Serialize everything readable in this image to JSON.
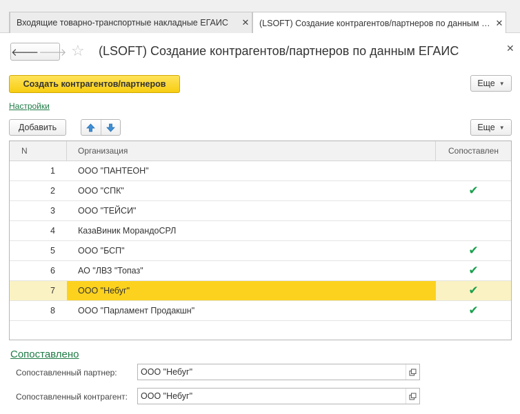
{
  "tabs": [
    {
      "label": "Входящие товарно-транспортные накладные ЕГАИС",
      "close": "✕"
    },
    {
      "label": "(LSOFT) Создание контрагентов/партнеров по данным ЕГАИС",
      "close": "✕"
    }
  ],
  "window": {
    "title": "(LSOFT) Создание контрагентов/партнеров по данным ЕГАИС",
    "close": "✕",
    "back_icon": "arrow-left-icon",
    "forward_icon": "arrow-right-icon",
    "favorite_icon": "star-icon"
  },
  "toolbar": {
    "create_label": "Создать контрагентов/партнеров",
    "more_label": "Еще"
  },
  "settings_link": "Настройки",
  "table_toolbar": {
    "add_label": "Добавить",
    "up_icon": "arrow-up-icon",
    "down_icon": "arrow-down-icon",
    "more_label": "Еще"
  },
  "table": {
    "columns": [
      "N",
      "Организация",
      "Сопоставлен"
    ],
    "rows": [
      {
        "n": "1",
        "org": "ООО \"ПАНТЕОН\"",
        "matched": false
      },
      {
        "n": "2",
        "org": "ООО \"СПК\"",
        "matched": true
      },
      {
        "n": "3",
        "org": "ООО \"ТЕЙСИ\"",
        "matched": false
      },
      {
        "n": "4",
        "org": "КазаВиник МорандоСРЛ",
        "matched": false
      },
      {
        "n": "5",
        "org": "ООО \"БСП\"",
        "matched": true
      },
      {
        "n": "6",
        "org": "АО \"ЛВЗ \"Топаз\"",
        "matched": true
      },
      {
        "n": "7",
        "org": "ООО \"Небуг\"",
        "matched": true
      },
      {
        "n": "8",
        "org": "ООО \"Парламент Продакшн\"",
        "matched": true
      }
    ],
    "selected_row": "7",
    "check_mark": "✔"
  },
  "matched_section": {
    "title": "Сопоставлено",
    "partner_label": "Сопоставленный партнер:",
    "partner_value": "ООО \"Небуг\"",
    "counterparty_label": "Сопоставленный контрагент:",
    "counterparty_value": "ООО \"Небуг\"",
    "open_icon": "open-item-icon"
  },
  "colors": {
    "accent_yellow": "#f7cd11",
    "selected_row": "#fbf2c4",
    "selected_cell": "#fcd21e",
    "link_green": "#1e7a45",
    "check_green": "#1aa14d"
  }
}
